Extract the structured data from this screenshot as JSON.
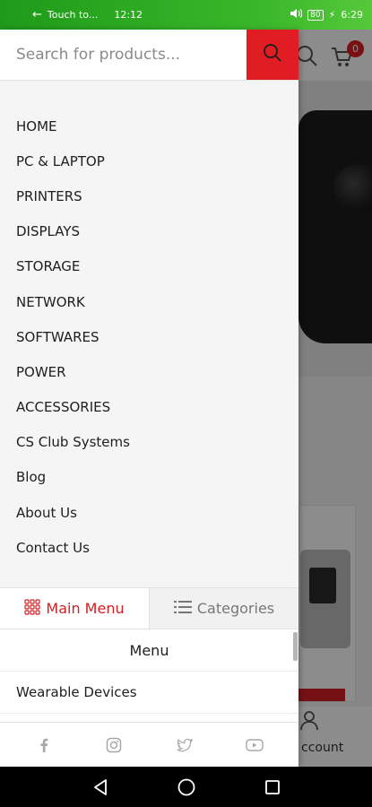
{
  "status_bar": {
    "left_text": "Touch to...",
    "time_left": "12:12",
    "battery_text": "80",
    "time_right": "6:29"
  },
  "search": {
    "placeholder": "Search for products...",
    "button_icon": "search-icon"
  },
  "header": {
    "cart_count": "0"
  },
  "drawer": {
    "menu_items": [
      {
        "label": "HOME"
      },
      {
        "label": "PC & LAPTOP"
      },
      {
        "label": "PRINTERS"
      },
      {
        "label": "DISPLAYS"
      },
      {
        "label": "STORAGE"
      },
      {
        "label": "NETWORK"
      },
      {
        "label": "SOFTWARES"
      },
      {
        "label": "POWER"
      },
      {
        "label": "ACCESSORIES"
      },
      {
        "label": "CS Club Systems"
      },
      {
        "label": "Blog"
      },
      {
        "label": "About Us"
      },
      {
        "label": "Contact Us"
      }
    ],
    "tabs": {
      "main_menu": "Main Menu",
      "categories": "Categories"
    },
    "menu_heading": "Menu",
    "submenu_item": "Wearable Devices",
    "social": [
      "facebook-icon",
      "instagram-icon",
      "twitter-icon",
      "youtube-icon"
    ]
  },
  "background": {
    "account_label": "ccount"
  },
  "colors": {
    "accent": "#e01d22",
    "status_bar": "#2da822",
    "drawer_bg": "#f5f5f5"
  }
}
